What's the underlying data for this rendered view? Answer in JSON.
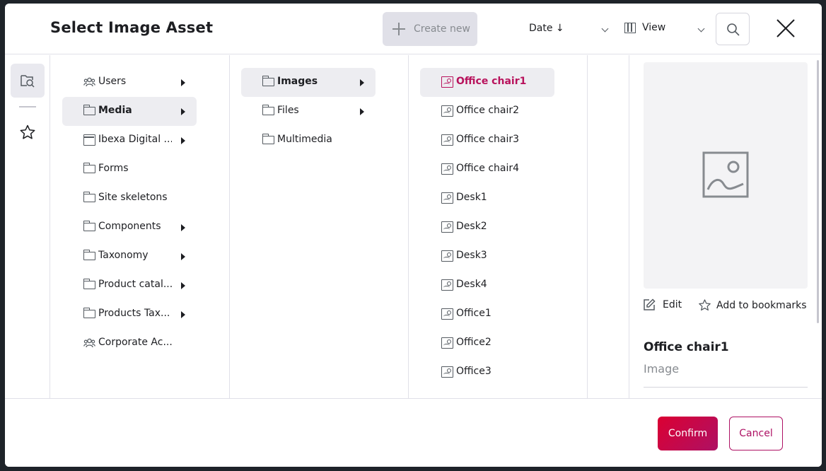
{
  "header": {
    "title": "Select Image Asset",
    "create_label": "Create new",
    "sort_label": "Date ↓",
    "view_label": "View"
  },
  "rail": {
    "items": [
      {
        "icon": "search-browse-icon",
        "active": true
      },
      {
        "icon": "star-icon",
        "active": false
      }
    ]
  },
  "columns": {
    "col1": [
      {
        "label": "Users",
        "icon": "users-group-icon",
        "has_children": true
      },
      {
        "label": "Media",
        "icon": "folder-icon",
        "has_children": true,
        "active": true
      },
      {
        "label": "Ibexa Digital ...",
        "icon": "site-icon",
        "has_children": true
      },
      {
        "label": "Forms",
        "icon": "folder-icon",
        "has_children": false
      },
      {
        "label": "Site skeletons",
        "icon": "folder-icon",
        "has_children": false
      },
      {
        "label": "Components",
        "icon": "folder-icon",
        "has_children": true
      },
      {
        "label": "Taxonomy",
        "icon": "folder-icon",
        "has_children": true
      },
      {
        "label": "Product catal...",
        "icon": "folder-icon",
        "has_children": true
      },
      {
        "label": "Products Tax...",
        "icon": "folder-icon",
        "has_children": true
      },
      {
        "label": "Corporate Ac...",
        "icon": "users-group-icon",
        "has_children": false
      }
    ],
    "col2": [
      {
        "label": "Images",
        "icon": "folder-icon",
        "has_children": true,
        "active": true
      },
      {
        "label": "Files",
        "icon": "folder-icon",
        "has_children": true
      },
      {
        "label": "Multimedia",
        "icon": "folder-icon",
        "has_children": false
      }
    ],
    "col3": [
      {
        "label": "Office chair1",
        "icon": "image-icon",
        "selected": true
      },
      {
        "label": "Office chair2",
        "icon": "image-icon"
      },
      {
        "label": "Office chair3",
        "icon": "image-icon"
      },
      {
        "label": "Office chair4",
        "icon": "image-icon"
      },
      {
        "label": "Desk1",
        "icon": "image-icon"
      },
      {
        "label": "Desk2",
        "icon": "image-icon"
      },
      {
        "label": "Desk3",
        "icon": "image-icon"
      },
      {
        "label": "Desk4",
        "icon": "image-icon"
      },
      {
        "label": "Office1",
        "icon": "image-icon"
      },
      {
        "label": "Office2",
        "icon": "image-icon"
      },
      {
        "label": "Office3",
        "icon": "image-icon"
      }
    ]
  },
  "preview": {
    "edit_label": "Edit",
    "bookmark_label": "Add to bookmarks",
    "name": "Office chair1",
    "type": "Image"
  },
  "footer": {
    "confirm_label": "Confirm",
    "cancel_label": "Cancel"
  },
  "colors": {
    "accent": "#ae1164",
    "confirm_gradient_start": "#db0032",
    "selected_bg": "#ededf1"
  }
}
